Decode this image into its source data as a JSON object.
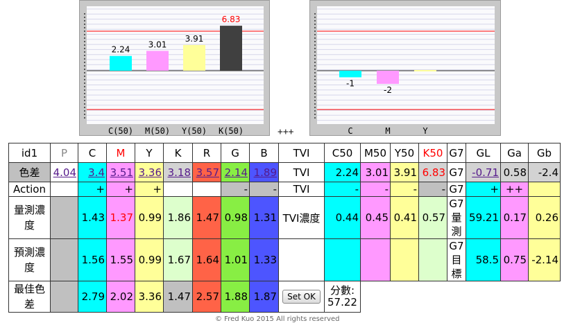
{
  "charts": {
    "left": {
      "values": [
        "2.24",
        "3.01",
        "3.91",
        "6.83"
      ],
      "labels": [
        "C(50)",
        "M(50)",
        "Y(50)",
        "K(50)"
      ]
    },
    "right": {
      "values": [
        "-1",
        "-2",
        ""
      ],
      "labels": [
        "C",
        "M",
        "Y"
      ]
    },
    "separator": "+++",
    "colors": {
      "c": "#00ffff",
      "m": "#ff99ff",
      "y": "#ffff99",
      "k": "#404040",
      "limit": "#ff0000",
      "red_text": "#ff0000"
    }
  },
  "chart_data": [
    {
      "type": "bar",
      "categories": [
        "C(50)",
        "M(50)",
        "Y(50)",
        "K(50)"
      ],
      "values": [
        2.24,
        3.01,
        3.91,
        6.83
      ],
      "ylim": [
        -6,
        6
      ]
    },
    {
      "type": "bar",
      "categories": [
        "C",
        "M",
        "Y"
      ],
      "values": [
        -1,
        -2,
        0
      ],
      "ylim": [
        -6,
        6
      ]
    }
  ],
  "table": {
    "header": [
      "id1",
      "P",
      "C",
      "M",
      "Y",
      "K",
      "R",
      "G",
      "B",
      "TVI",
      "C50",
      "M50",
      "Y50",
      "K50",
      "G7",
      "GL",
      "Ga",
      "Gb"
    ],
    "delta": {
      "label": "色差",
      "values": [
        "4.04",
        "3.4",
        "3.51",
        "3.36",
        "3.18",
        "3.57",
        "2.14",
        "1.89"
      ],
      "tvi": "TVI",
      "tvi_values": [
        "2.24",
        "3.01",
        "3.91",
        "6.83"
      ],
      "g7": "G7",
      "g_values": [
        "-0.71",
        "0.58",
        "-2.4"
      ]
    },
    "action": {
      "label": "Action",
      "values": [
        "",
        "+",
        "+",
        "+",
        "",
        "",
        "-",
        "-"
      ],
      "tvi": "TVI",
      "tvi_values": [
        "-",
        "-",
        "-",
        "-"
      ],
      "g7": "G7",
      "g_values": [
        "+",
        "++",
        ""
      ]
    },
    "measured": {
      "label": "量測濃度",
      "values": [
        "",
        "1.43",
        "1.37",
        "0.99",
        "1.86",
        "1.47",
        "0.98",
        "1.31"
      ],
      "tvi": "TVI濃度",
      "tvi_values": [
        "0.44",
        "0.45",
        "0.41",
        "0.57"
      ],
      "g7": "G7量測",
      "g_values": [
        "59.21",
        "0.17",
        "0.26"
      ]
    },
    "predicted": {
      "label": "預測濃度",
      "values": [
        "",
        "1.56",
        "1.55",
        "0.99",
        "1.67",
        "1.64",
        "1.01",
        "1.33"
      ],
      "tvi": "",
      "tvi_values": [
        "",
        "",
        "",
        ""
      ],
      "g7": "G7目標",
      "g_values": [
        "58.5",
        "0.75",
        "-2.14"
      ]
    },
    "best": {
      "label": "最佳色差",
      "values": [
        "",
        "2.79",
        "2.02",
        "3.36",
        "1.47",
        "2.57",
        "1.88",
        "1.87"
      ],
      "button": "Set OK",
      "score_label": "分數:",
      "score": "57.22"
    }
  },
  "footer": "© Fred Kuo 2015 All rights reserved"
}
